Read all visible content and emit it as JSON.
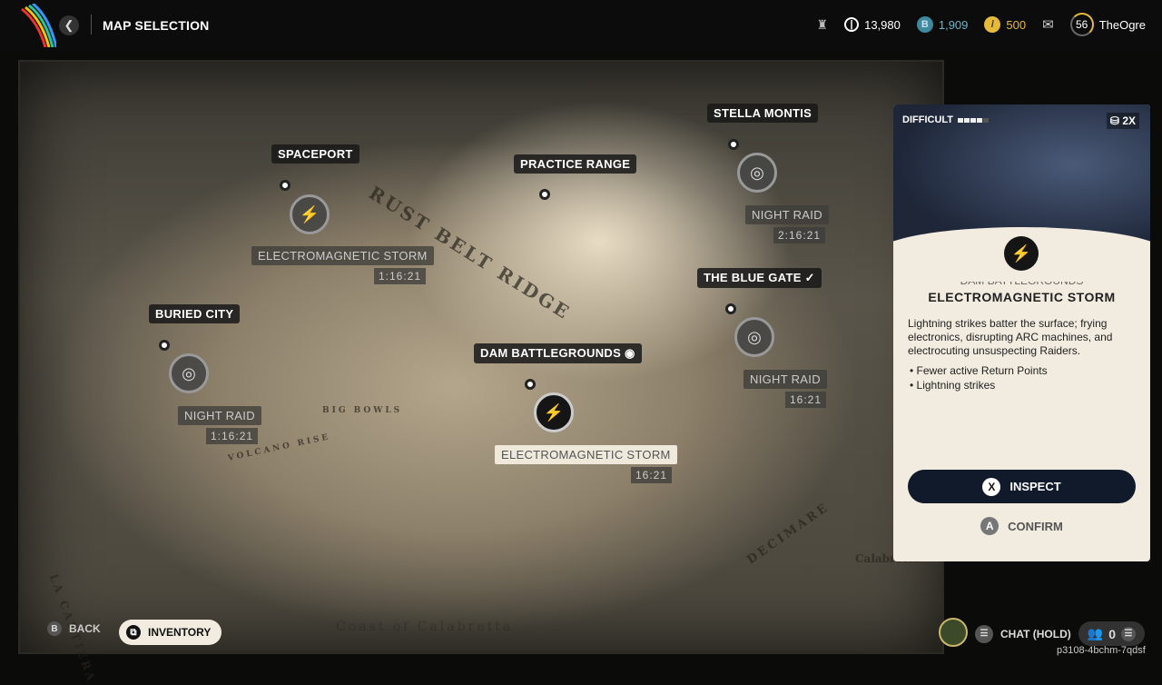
{
  "header": {
    "title": "MAP SELECTION",
    "back_icon": "chevron-left-icon"
  },
  "stats": {
    "coins": "13,980",
    "blue_currency": "1,909",
    "gold_currency": "500",
    "level": "56",
    "username": "TheOgre"
  },
  "map": {
    "regions": [
      "RUST BELT RIDGE",
      "VOLCANO RISE",
      "BIG BOWLS",
      "LA CARTIERA",
      "DECIMARE",
      "Coast of Calabretta",
      "Calabretta"
    ],
    "locations": [
      {
        "name": "SPACEPORT",
        "modifier": "ELECTROMAGNETIC STORM",
        "timer": "1:16:21"
      },
      {
        "name": "PRACTICE RANGE"
      },
      {
        "name": "STELLA MONTIS",
        "modifier": "NIGHT RAID",
        "timer": "2:16:21"
      },
      {
        "name": "BURIED CITY",
        "modifier": "NIGHT RAID",
        "timer": "1:16:21"
      },
      {
        "name": "THE BLUE GATE",
        "modifier": "NIGHT RAID",
        "timer": "16:21"
      },
      {
        "name": "DAM BATTLEGROUNDS",
        "modifier": "ELECTROMAGNETIC STORM",
        "timer": "16:21"
      }
    ]
  },
  "panel": {
    "difficulty_label": "DIFFICULT",
    "difficulty_level": 4,
    "difficulty_max": 5,
    "multiplier": "2X",
    "location": "DAM BATTLEGROUNDS",
    "title": "ELECTROMAGNETIC STORM",
    "description": "Lightning strikes batter the surface; frying electronics, disrupting ARC machines, and electrocuting unsuspecting Raiders.",
    "bullets": [
      "Fewer active Return Points",
      "Lightning strikes"
    ],
    "inspect": {
      "key": "X",
      "label": "INSPECT"
    },
    "confirm": {
      "key": "A",
      "label": "CONFIRM"
    }
  },
  "footer": {
    "back_key": "B",
    "back": "BACK",
    "inventory": "INVENTORY",
    "chat": "CHAT (HOLD)",
    "party_count": "0",
    "session_code": "p3108-4bchm-7qdsf"
  }
}
